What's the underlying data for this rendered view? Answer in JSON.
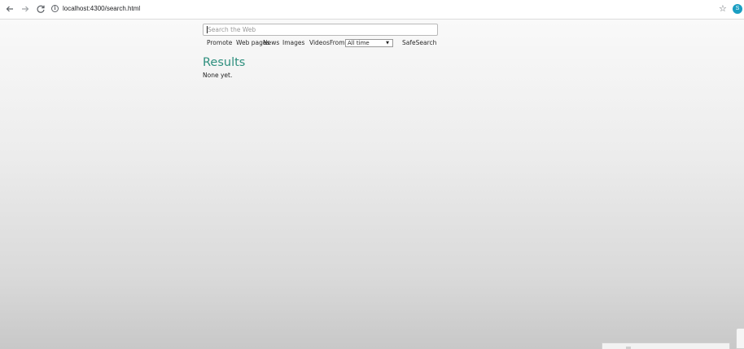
{
  "browser": {
    "url": "localhost:4300/search.html",
    "profile_initial": "S",
    "icons": {
      "back": "arrow-left-icon",
      "forward": "arrow-right-icon",
      "reload": "reload-icon",
      "info": "info-icon",
      "bookmark": "star-icon"
    },
    "avatar_color": "#1a9ec2"
  },
  "search": {
    "placeholder": "Search the Web",
    "value": ""
  },
  "filters": {
    "promote": "Promote",
    "web": "Web pages",
    "news": "News",
    "images": "Images",
    "videos": "Videos",
    "from_label": "From",
    "time_selected": "All time",
    "safesearch": "SafeSearch"
  },
  "results": {
    "title": "Results",
    "empty_text": "None yet."
  },
  "colors": {
    "results_title": "#2e8f7e"
  }
}
